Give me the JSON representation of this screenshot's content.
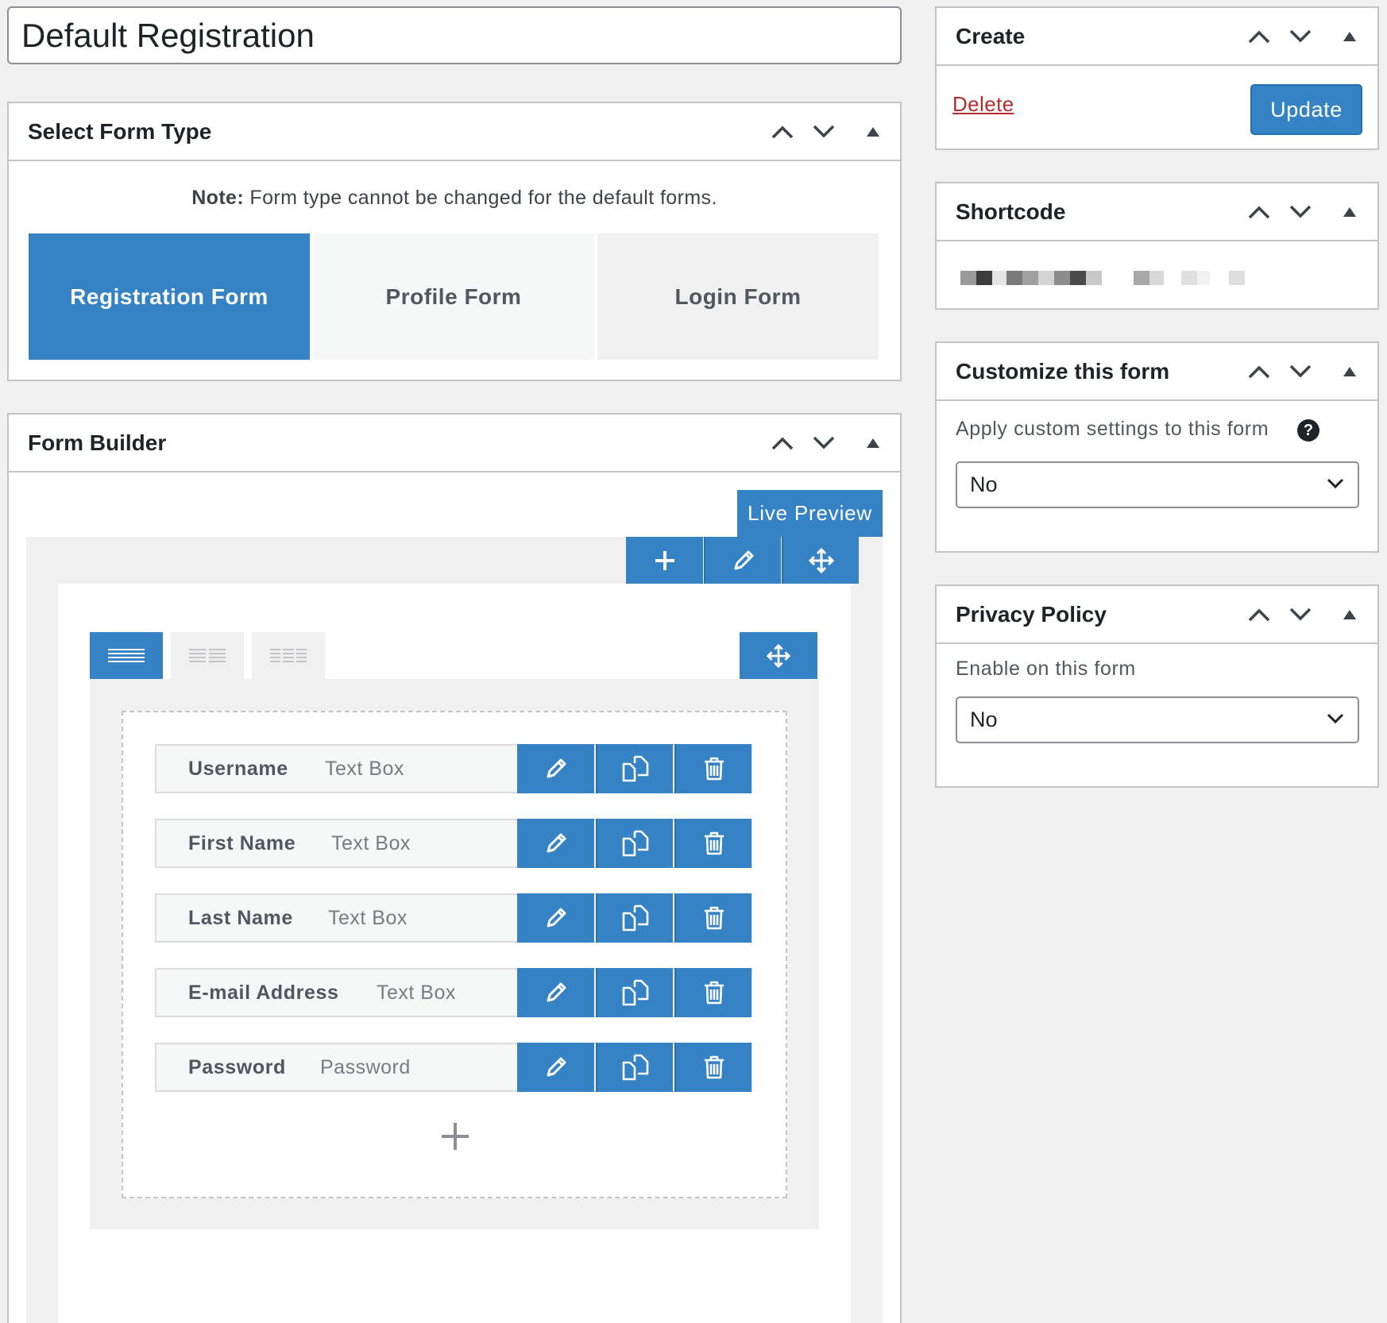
{
  "title": "Default Registration",
  "colors": {
    "primary": "#3582c4",
    "delete": "#b32d2e",
    "border": "#c3c4c7",
    "background": "#f0f0f1"
  },
  "select_form_type": {
    "title": "Select Form Type",
    "note_label": "Note:",
    "note_text": " Form type cannot be changed for the default forms.",
    "types": [
      {
        "label": "Registration Form",
        "active": true
      },
      {
        "label": "Profile Form",
        "active": false
      },
      {
        "label": "Login Form",
        "active": false
      }
    ]
  },
  "form_builder": {
    "title": "Form Builder",
    "live_preview_label": "Live Preview",
    "row_toolbar_icons": [
      "plus-icon",
      "pencil-icon",
      "move-icon"
    ],
    "column_layouts": [
      "one-column-icon",
      "two-column-icon",
      "three-column-icon"
    ],
    "fields": [
      {
        "label": "Username",
        "type": "Text Box"
      },
      {
        "label": "First Name",
        "type": "Text Box"
      },
      {
        "label": "Last Name",
        "type": "Text Box"
      },
      {
        "label": "E-mail Address",
        "type": "Text Box"
      },
      {
        "label": "Password",
        "type": "Password"
      }
    ],
    "field_actions": [
      "pencil-icon",
      "duplicate-icon",
      "trash-icon"
    ]
  },
  "create": {
    "title": "Create",
    "delete_label": "Delete",
    "update_label": "Update"
  },
  "shortcode": {
    "title": "Shortcode"
  },
  "customize": {
    "title": "Customize this form",
    "label": "Apply custom settings to this form",
    "help_icon": "?",
    "value": "No"
  },
  "privacy": {
    "title": "Privacy Policy",
    "label": "Enable on this form",
    "value": "No"
  }
}
